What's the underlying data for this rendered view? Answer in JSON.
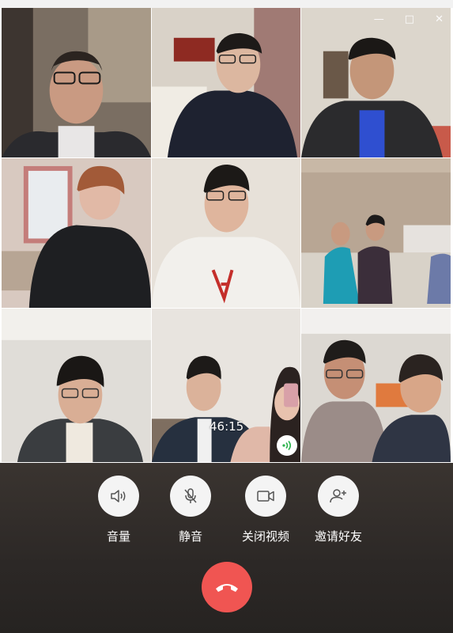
{
  "call": {
    "timer": "46:15"
  },
  "window": {
    "controls": [
      "minimize-icon",
      "maximize-icon",
      "close-icon"
    ]
  },
  "participants": [
    {
      "id": "p1",
      "bg": "#6b6258",
      "shirt": "#2a2a2e",
      "skin": "#c99a82"
    },
    {
      "id": "p2",
      "bg": "#d9d2c8",
      "shirt": "#1e2230",
      "skin": "#dcb7a0"
    },
    {
      "id": "p3",
      "bg": "#dcd6cc",
      "shirt": "#2b2b2d",
      "skin": "#c49679"
    },
    {
      "id": "p4",
      "bg": "#d8c9c0",
      "shirt": "#1e1f22",
      "skin": "#e1b9a6"
    },
    {
      "id": "p5",
      "bg": "#e7e1d9",
      "shirt": "#f2f0ec",
      "skin": "#dfb59d"
    },
    {
      "id": "p6",
      "bg": "#d4c6b6",
      "shirt": "#3b2e3a",
      "skin": "#c89a80"
    },
    {
      "id": "p7",
      "bg": "#e0ddd8",
      "shirt": "#3a3d40",
      "skin": "#d9ae95"
    },
    {
      "id": "p8",
      "bg": "#e8e4df",
      "shirt": "#26303f",
      "skin": "#dbb29a"
    },
    {
      "id": "p9",
      "bg": "#dcd8d2",
      "shirt": "#2f3544",
      "skin": "#c58f75"
    }
  ],
  "controls": {
    "volume": {
      "label": "音量",
      "icon": "speaker-icon"
    },
    "mute": {
      "label": "静音",
      "icon": "mic-off-icon"
    },
    "camera": {
      "label": "关闭视频",
      "icon": "video-camera-icon"
    },
    "invite": {
      "label": "邀请好友",
      "icon": "add-person-icon"
    },
    "hangup": {
      "icon": "hang-up-icon",
      "color": "#f05552"
    }
  }
}
